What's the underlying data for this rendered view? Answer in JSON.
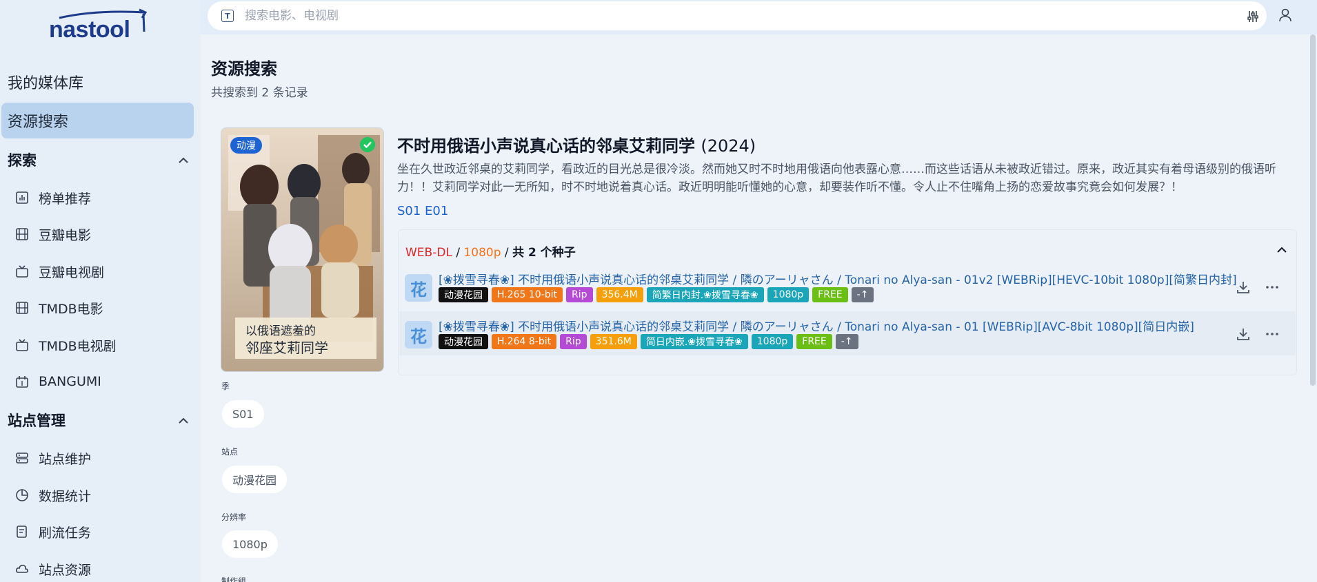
{
  "app": {
    "logo_text": "nastool"
  },
  "search": {
    "placeholder": "搜索电影、电视剧"
  },
  "sidebar": {
    "top_items": [
      {
        "label": "我的媒体库"
      },
      {
        "label": "资源搜索",
        "active": true
      }
    ],
    "sections": [
      {
        "label": "探索",
        "items": [
          {
            "label": "榜单推荐",
            "icon": "chart-icon"
          },
          {
            "label": "豆瓣电影",
            "icon": "film-icon"
          },
          {
            "label": "豆瓣电视剧",
            "icon": "tv-icon"
          },
          {
            "label": "TMDB电影",
            "icon": "film-icon"
          },
          {
            "label": "TMDB电视剧",
            "icon": "tv-icon"
          },
          {
            "label": "BANGUMI",
            "icon": "calendar-icon"
          }
        ]
      },
      {
        "label": "站点管理",
        "items": [
          {
            "label": "站点维护",
            "icon": "server-icon"
          },
          {
            "label": "数据统计",
            "icon": "pie-chart-icon"
          },
          {
            "label": "刷流任务",
            "icon": "task-icon"
          },
          {
            "label": "站点资源",
            "icon": "cloud-icon"
          }
        ]
      }
    ]
  },
  "main": {
    "title": "资源搜索",
    "subtitle": "共搜索到 2 条记录",
    "media": {
      "badge": "动漫",
      "title": "不时用俄语小声说真心话的邻桌艾莉同学",
      "year": "(2024)",
      "description": "坐在久世政近邻桌的艾莉同学，看政近的目光总是很冷淡。然而她又时不时地用俄语向他表露心意……而这些话语从未被政近错过。原来，政近其实有着母语级别的俄语听力！！艾莉同学对此一无所知，时不时地说着真心话。政近明明能听懂她的心意，却要装作听不懂。令人止不住嘴角上扬的恋爱故事究竟会如何发展？！",
      "episode": "S01 E01"
    },
    "group": {
      "source": "WEB-DL",
      "sep1": " / ",
      "resolution": "1080p",
      "sep2": " / ",
      "count": "共 2 个种子"
    },
    "torrents": [
      {
        "site_icon": "花",
        "name": "[❀拨雪寻春❀] 不时用俄语小声说真心话的邻桌艾莉同学 / 隣のアーリャさん / Tonari no Alya-san - 01v2 [WEBRip][HEVC-10bit 1080p][简繁日内封]",
        "tags": {
          "site": "动漫花园",
          "codec": "H.265 10-bit",
          "rip": "Rip",
          "size": "356.4M",
          "team": "简繁日内封.❀拨雪寻春❀",
          "res": "1080p",
          "free": "FREE",
          "peers": "-↑"
        }
      },
      {
        "site_icon": "花",
        "name": "[❀拨雪寻春❀] 不时用俄语小声说真心话的邻桌艾莉同学 / 隣のアーリャさん / Tonari no Alya-san - 01 [WEBRip][AVC-8bit 1080p][简日内嵌]",
        "tags": {
          "site": "动漫花园",
          "codec": "H.264 8-bit",
          "rip": "Rip",
          "size": "351.6M",
          "team": "简日内嵌.❀拨雪寻春❀",
          "res": "1080p",
          "free": "FREE",
          "peers": "-↑"
        }
      }
    ],
    "filters": [
      {
        "label": "季",
        "value": "S01"
      },
      {
        "label": "站点",
        "value": "动漫花园"
      },
      {
        "label": "分辨率",
        "value": "1080p"
      },
      {
        "label": "制作组",
        "value": ""
      }
    ]
  }
}
